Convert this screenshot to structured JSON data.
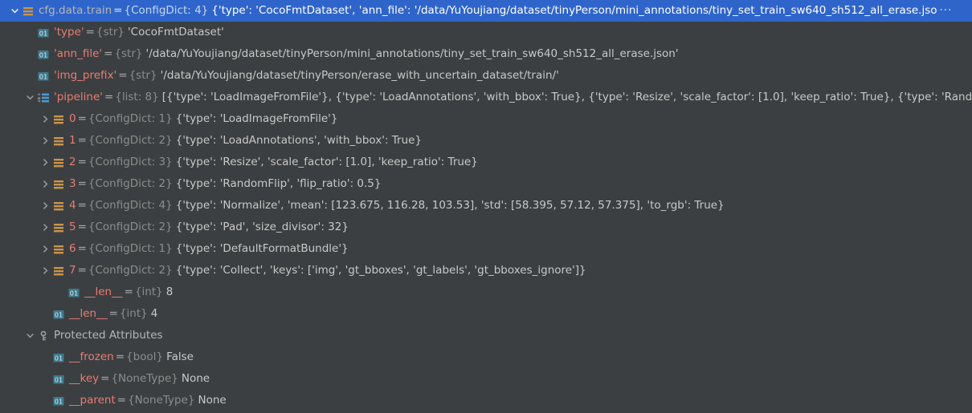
{
  "panel": {
    "name": "debugger-variables-tree",
    "background": "#3C3F41",
    "selection_color": "#2F65CA",
    "key_color": "#E87C73",
    "type_color": "#8C8C8C",
    "value_color": "#C8C8C8",
    "overflow_ellipsis": "···"
  },
  "rows": [
    {
      "id": "cfg-data-train",
      "indent": 0,
      "expander": "expanded",
      "icon": "dict-icon",
      "name": "cfg.data.train",
      "name_style": "plain",
      "eq": "=",
      "type": "{ConfigDict: 4}",
      "value": "{'type': 'CocoFmtDataset', 'ann_file': '/data/YuYoujiang/dataset/tinyPerson/mini_annotations/tiny_set_train_sw640_sh512_all_erase.jso",
      "selected": true,
      "truncated": true
    },
    {
      "id": "type",
      "indent": 1,
      "expander": "none",
      "icon": "field-01-icon",
      "name": "'type'",
      "name_style": "key",
      "eq": "=",
      "type": "{str}",
      "value": "'CocoFmtDataset'",
      "selected": false,
      "truncated": false
    },
    {
      "id": "ann-file",
      "indent": 1,
      "expander": "none",
      "icon": "field-01-icon",
      "name": "'ann_file'",
      "name_style": "key",
      "eq": "=",
      "type": "{str}",
      "value": "'/data/YuYoujiang/dataset/tinyPerson/mini_annotations/tiny_set_train_sw640_sh512_all_erase.json'",
      "selected": false,
      "truncated": false
    },
    {
      "id": "img-prefix",
      "indent": 1,
      "expander": "none",
      "icon": "field-01-icon",
      "name": "'img_prefix'",
      "name_style": "key",
      "eq": "=",
      "type": "{str}",
      "value": "'/data/YuYoujiang/dataset/tinyPerson/erase_with_uncertain_dataset/train/'",
      "selected": false,
      "truncated": false
    },
    {
      "id": "pipeline",
      "indent": 1,
      "expander": "expanded",
      "icon": "list-icon",
      "name": "'pipeline'",
      "name_style": "key",
      "eq": "=",
      "type": "{list: 8}",
      "value": "[{'type': 'LoadImageFromFile'}, {'type': 'LoadAnnotations', 'with_bbox': True}, {'type': 'Resize', 'scale_factor': [1.0], 'keep_ratio': True}, {'type': 'Rand ",
      "selected": false,
      "truncated": true
    },
    {
      "id": "pipeline-0",
      "indent": 2,
      "expander": "collapsed",
      "icon": "dict-icon",
      "name": "0",
      "name_style": "index",
      "eq": "=",
      "type": "{ConfigDict: 1}",
      "value": "{'type': 'LoadImageFromFile'}",
      "selected": false,
      "truncated": false
    },
    {
      "id": "pipeline-1",
      "indent": 2,
      "expander": "collapsed",
      "icon": "dict-icon",
      "name": "1",
      "name_style": "index",
      "eq": "=",
      "type": "{ConfigDict: 2}",
      "value": "{'type': 'LoadAnnotations', 'with_bbox': True}",
      "selected": false,
      "truncated": false
    },
    {
      "id": "pipeline-2",
      "indent": 2,
      "expander": "collapsed",
      "icon": "dict-icon",
      "name": "2",
      "name_style": "index",
      "eq": "=",
      "type": "{ConfigDict: 3}",
      "value": "{'type': 'Resize', 'scale_factor': [1.0], 'keep_ratio': True}",
      "selected": false,
      "truncated": false
    },
    {
      "id": "pipeline-3",
      "indent": 2,
      "expander": "collapsed",
      "icon": "dict-icon",
      "name": "3",
      "name_style": "index",
      "eq": "=",
      "type": "{ConfigDict: 2}",
      "value": "{'type': 'RandomFlip', 'flip_ratio': 0.5}",
      "selected": false,
      "truncated": false
    },
    {
      "id": "pipeline-4",
      "indent": 2,
      "expander": "collapsed",
      "icon": "dict-icon",
      "name": "4",
      "name_style": "index",
      "eq": "=",
      "type": "{ConfigDict: 4}",
      "value": "{'type': 'Normalize', 'mean': [123.675, 116.28, 103.53], 'std': [58.395, 57.12, 57.375], 'to_rgb': True}",
      "selected": false,
      "truncated": false
    },
    {
      "id": "pipeline-5",
      "indent": 2,
      "expander": "collapsed",
      "icon": "dict-icon",
      "name": "5",
      "name_style": "index",
      "eq": "=",
      "type": "{ConfigDict: 2}",
      "value": "{'type': 'Pad', 'size_divisor': 32}",
      "selected": false,
      "truncated": false
    },
    {
      "id": "pipeline-6",
      "indent": 2,
      "expander": "collapsed",
      "icon": "dict-icon",
      "name": "6",
      "name_style": "index",
      "eq": "=",
      "type": "{ConfigDict: 1}",
      "value": "{'type': 'DefaultFormatBundle'}",
      "selected": false,
      "truncated": false
    },
    {
      "id": "pipeline-7",
      "indent": 2,
      "expander": "collapsed",
      "icon": "dict-icon",
      "name": "7",
      "name_style": "index",
      "eq": "=",
      "type": "{ConfigDict: 2}",
      "value": "{'type': 'Collect', 'keys': ['img', 'gt_bboxes', 'gt_labels', 'gt_bboxes_ignore']}",
      "selected": false,
      "truncated": false
    },
    {
      "id": "pipeline-len",
      "indent": 3,
      "expander": "none",
      "icon": "field-01-icon",
      "name": "__len__",
      "name_style": "key",
      "eq": "=",
      "type": "{int}",
      "value": "8",
      "selected": false,
      "truncated": false
    },
    {
      "id": "train-len",
      "indent": 2,
      "expander": "none",
      "icon": "field-01-icon",
      "name": "__len__",
      "name_style": "key",
      "eq": "=",
      "type": "{int}",
      "value": "4",
      "selected": false,
      "truncated": false
    },
    {
      "id": "protected-attributes",
      "indent": 1,
      "expander": "expanded",
      "icon": "key-icon",
      "name": "Protected Attributes",
      "name_style": "plain",
      "eq": "",
      "type": "",
      "value": "",
      "selected": false,
      "truncated": false
    },
    {
      "id": "frozen",
      "indent": 2,
      "expander": "none",
      "icon": "field-01-icon",
      "name": "__frozen",
      "name_style": "key",
      "eq": "=",
      "type": "{bool}",
      "value": "False",
      "selected": false,
      "truncated": false
    },
    {
      "id": "key",
      "indent": 2,
      "expander": "none",
      "icon": "field-01-icon",
      "name": "__key",
      "name_style": "key",
      "eq": "=",
      "type": "{NoneType}",
      "value": "None",
      "selected": false,
      "truncated": false
    },
    {
      "id": "parent",
      "indent": 2,
      "expander": "none",
      "icon": "field-01-icon",
      "name": "__parent",
      "name_style": "key",
      "eq": "=",
      "type": "{NoneType}",
      "value": "None",
      "selected": false,
      "truncated": false
    }
  ]
}
